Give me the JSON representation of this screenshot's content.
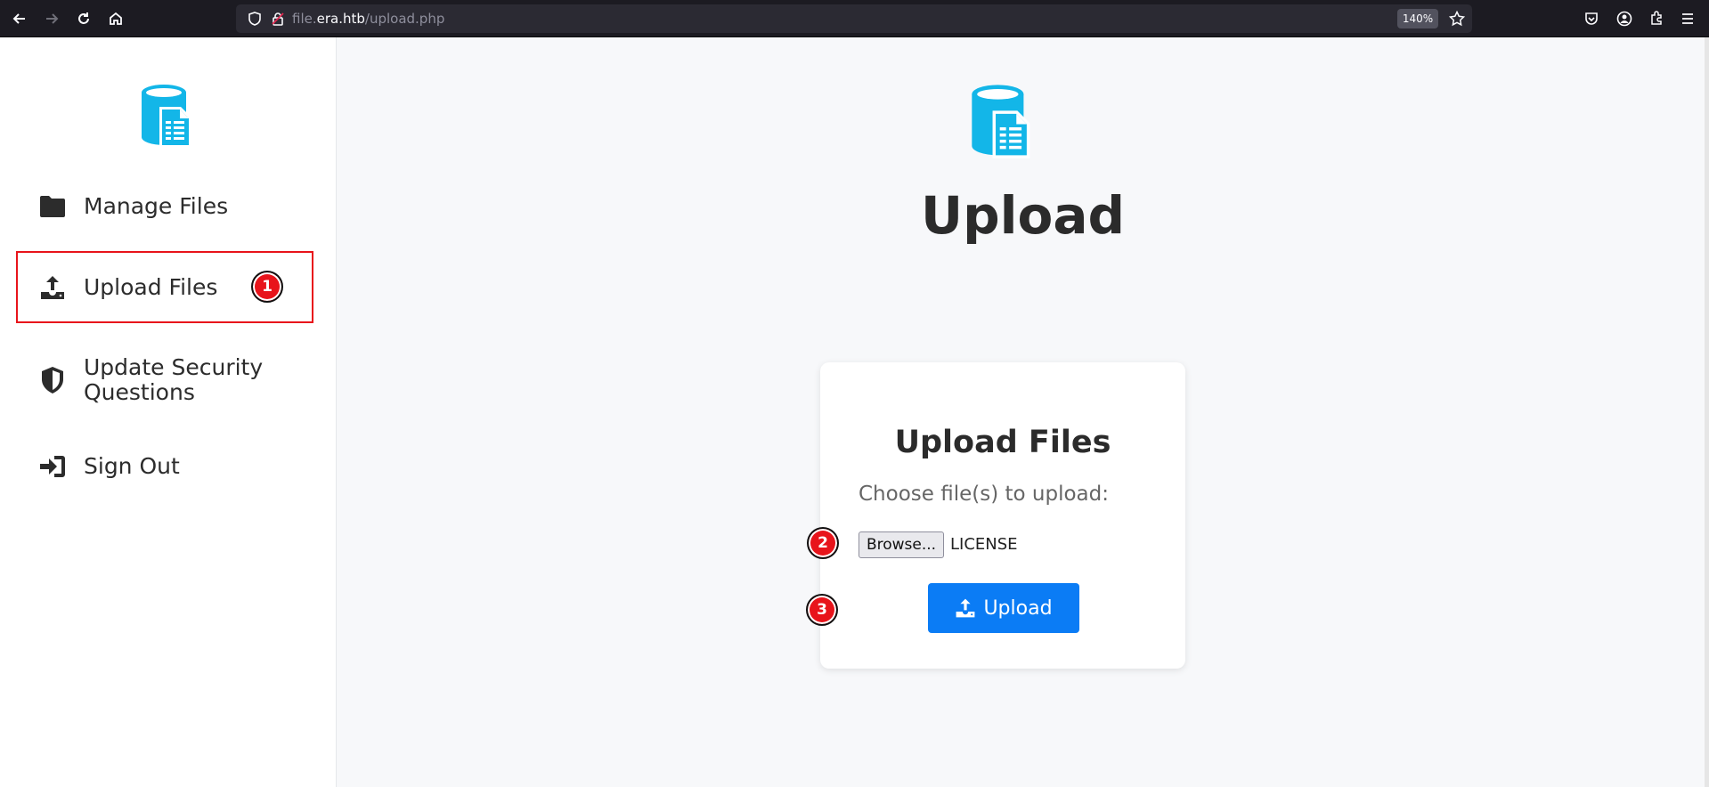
{
  "browser": {
    "url_prefix": "file.",
    "url_host": "era.htb",
    "url_path": "/upload.php",
    "zoom": "140%"
  },
  "sidebar": {
    "items": [
      {
        "label": "Manage Files",
        "icon": "folder-icon"
      },
      {
        "label": "Upload Files",
        "icon": "upload-icon"
      },
      {
        "label": "Update Security Questions",
        "icon": "shield-icon"
      },
      {
        "label": "Sign Out",
        "icon": "sign-out-icon"
      }
    ]
  },
  "main": {
    "title": "Upload",
    "card": {
      "title": "Upload Files",
      "choose_label": "Choose file(s) to upload:",
      "browse_label": "Browse...",
      "file_name": "LICENSE",
      "upload_label": "Upload"
    }
  },
  "annotations": [
    "1",
    "2",
    "3"
  ],
  "colors": {
    "accent": "#0b7cf5",
    "logo": "#13b6e8",
    "annotation": "#e8141b"
  }
}
